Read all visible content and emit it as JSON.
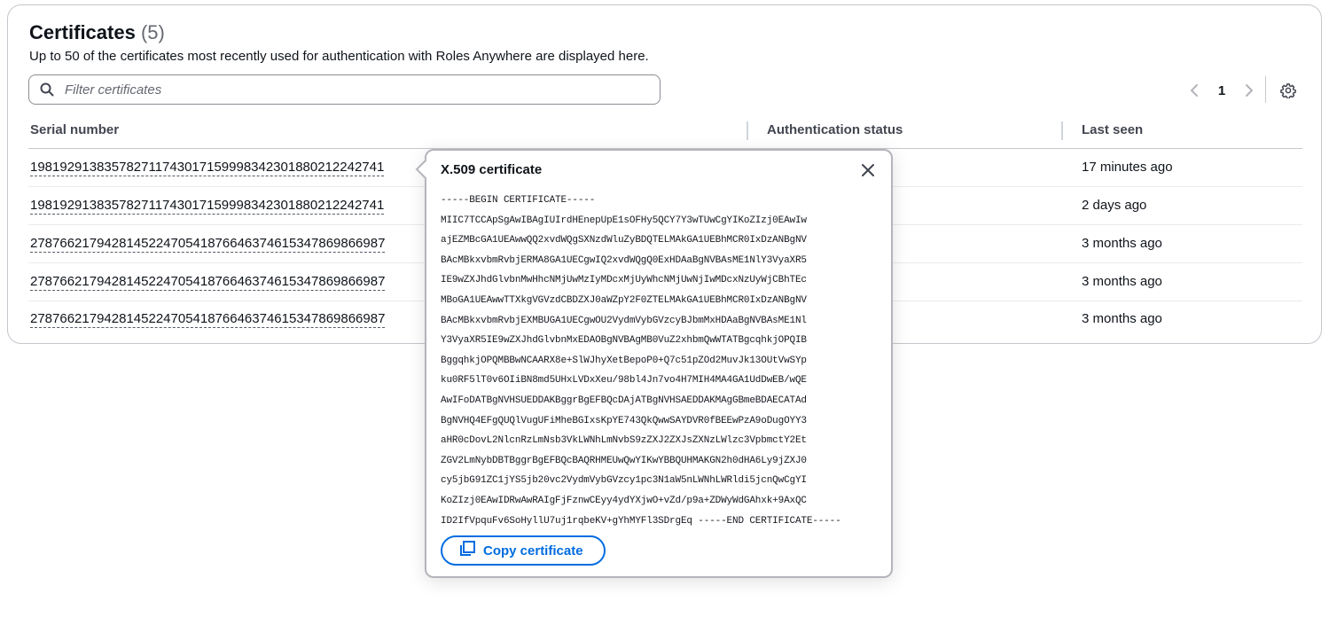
{
  "section": {
    "title": "Certificates",
    "count": "(5)",
    "description": "Up to 50 of the certificates most recently used for authentication with Roles Anywhere are displayed here."
  },
  "filter": {
    "placeholder": "Filter certificates",
    "value": ""
  },
  "pagination": {
    "current_page": "1"
  },
  "table": {
    "columns": [
      "Serial number",
      "Authentication status",
      "Last seen"
    ],
    "rows": [
      {
        "serial": "198192913835782711743017159998342301880212242741",
        "last_seen": "17 minutes ago"
      },
      {
        "serial": "198192913835782711743017159998342301880212242741",
        "last_seen": "2 days ago"
      },
      {
        "serial": "278766217942814522470541876646374615347869866987",
        "last_seen": "3 months ago"
      },
      {
        "serial": "278766217942814522470541876646374615347869866987",
        "last_seen": "3 months ago"
      },
      {
        "serial": "278766217942814522470541876646374615347869866987",
        "last_seen": "3 months ago"
      }
    ]
  },
  "popover": {
    "title": "X.509 certificate",
    "pem_lines": [
      "-----BEGIN CERTIFICATE-----",
      "MIIC7TCCApSgAwIBAgIUIrdHEnepUpE1sOFHy5QCY7Y3wTUwCgYIKoZIzj0EAwIw",
      "ajEZMBcGA1UEAwwQQ2xvdWQgSXNzdWluZyBDQTELMAkGA1UEBhMCR0IxDzANBgNV",
      "BAcMBkxvbmRvbjERMA8GA1UECgwIQ2xvdWQgQ0ExHDAaBgNVBAsME1NlY3VyaXR5",
      "IE9wZXJhdGlvbnMwHhcNMjUwMzIyMDcxMjUyWhcNMjUwNjIwMDcxNzUyWjCBhTEc",
      "MBoGA1UEAwwTTXkgVGVzdCBDZXJ0aWZpY2F0ZTELMAkGA1UEBhMCR0IxDzANBgNV",
      "BAcMBkxvbmRvbjEXMBUGA1UECgwOU2VydmVybGVzcyBJbmMxHDAaBgNVBAsME1Nl",
      "Y3VyaXR5IE9wZXJhdGlvbnMxEDAOBgNVBAgMB0VuZ2xhbmQwWTATBgcqhkjOPQIB",
      "BggqhkjOPQMBBwNCAARX8e+SlWJhyXetBepoP0+Q7c51pZOd2MuvJk13OUtVwSYp",
      "ku0RF5lT0v6OIiBN8md5UHxLVDxXeu/98bl4Jn7vo4H7MIH4MA4GA1UdDwEB/wQE",
      "AwIFoDATBgNVHSUEDDAKBggrBgEFBQcDAjATBgNVHSAEDDAKMAgGBmeBDAECATAd",
      "BgNVHQ4EFgQUQlVugUFiMheBGIxsKpYE743QkQwwSAYDVR0fBEEwPzA9oDugOYY3",
      "aHR0cDovL2NlcnRzLmNsb3VkLWNhLmNvbS9zZXJ2ZXJsZXNzLWlzc3VpbmctY2Et",
      "ZGV2LmNybDBTBggrBgEFBQcBAQRHMEUwQwYIKwYBBQUHMAKGN2h0dHA6Ly9jZXJ0",
      "cy5jbG91ZC1jYS5jb20vc2VydmVybGVzcy1pc3N1aW5nLWNhLWRldi5jcnQwCgYI",
      "KoZIzj0EAwIDRwAwRAIgFjFznwCEyy4ydYXjwO+vZd/p9a+ZDWyWdGAhxk+9AxQC",
      "ID2IfVpquFv6SoHyllU7uj1rqbeKV+gYhMYFl3SDrgEq -----END CERTIFICATE-----"
    ],
    "copy_button_label": "Copy certificate"
  },
  "icons": {
    "search": "search-icon",
    "prev": "chevron-left-icon",
    "next": "chevron-right-icon",
    "settings": "gear-icon",
    "close": "close-icon",
    "copy": "copy-icon"
  },
  "colors": {
    "link_blue": "#006ce0",
    "border": "#c6c6cd",
    "text": "#0f141a",
    "muted": "#656871"
  }
}
